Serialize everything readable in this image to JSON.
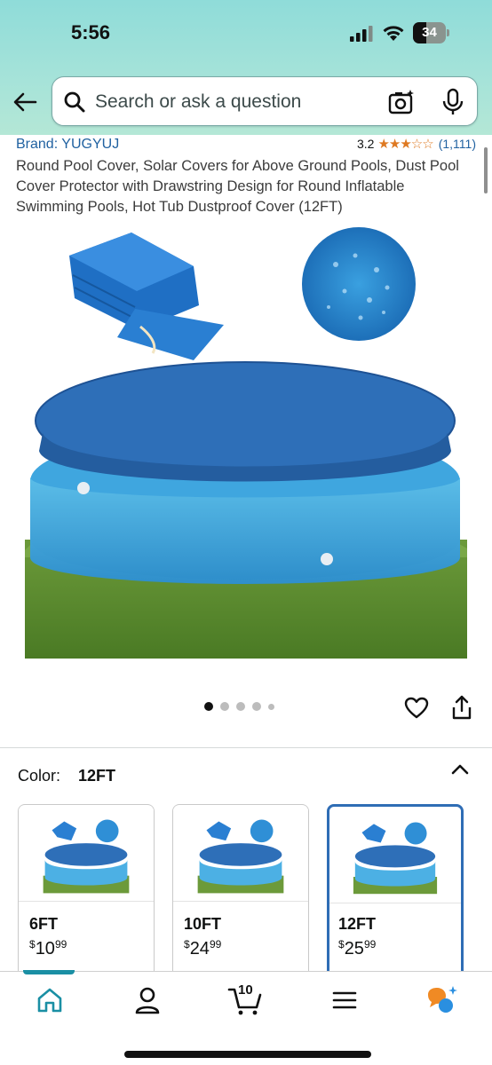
{
  "status_bar": {
    "time": "5:56",
    "battery": "34"
  },
  "search": {
    "placeholder": "Search or ask a question"
  },
  "product": {
    "brand": "Brand: YUGYUJ",
    "rating": "3.2",
    "stars_text": "★★★☆☆",
    "rating_value": 3.2,
    "rating_count": "(1,111)",
    "title": "Round Pool Cover, Solar Covers for Above Ground Pools, Dust Pool Cover Protector with Drawstring Design for Round Inflatable Swimming Pools, Hot Tub Dustproof Cover (12FT)"
  },
  "gallery": {
    "image_count": 5,
    "active_index": 0
  },
  "color_selector": {
    "label": "Color:",
    "selected": "12FT",
    "options": [
      {
        "name": "6FT",
        "price_currency": "$",
        "price_whole": "10",
        "price_cents": "99"
      },
      {
        "name": "10FT",
        "price_currency": "$",
        "price_whole": "24",
        "price_cents": "99"
      },
      {
        "name": "12FT",
        "price_currency": "$",
        "price_whole": "25",
        "price_cents": "99"
      }
    ]
  },
  "bottom_nav": {
    "cart_count": "10",
    "items": [
      "home-icon",
      "account-icon",
      "cart-icon",
      "menu-icon",
      "rufus-icon"
    ]
  },
  "colors": {
    "accent_blue": "#2162a1",
    "star_orange": "#de7921",
    "selected_border": "#2f6db5",
    "nav_indicator": "#1a8fa4",
    "header_teal": "#a6e3d9"
  }
}
